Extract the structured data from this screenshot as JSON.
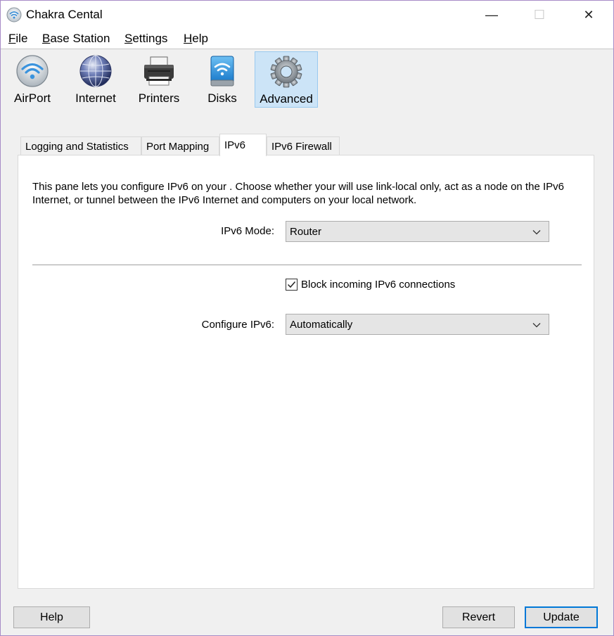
{
  "window": {
    "title": "Chakra Cental",
    "minimize_glyph": "—",
    "maximize_glyph": "☐",
    "close_glyph": "✕"
  },
  "menu": [
    {
      "label_u": "F",
      "label_rest": "ile"
    },
    {
      "label_u": "B",
      "label_rest": "ase Station"
    },
    {
      "label_u": "S",
      "label_rest": "ettings"
    },
    {
      "label_u": "H",
      "label_rest": "elp"
    }
  ],
  "toolbar": [
    {
      "label": "AirPort",
      "icon": "airport-wifi-icon"
    },
    {
      "label": "Internet",
      "icon": "globe-icon"
    },
    {
      "label": "Printers",
      "icon": "printer-icon"
    },
    {
      "label": "Disks",
      "icon": "disk-icon"
    },
    {
      "label": "Advanced",
      "icon": "gear-icon",
      "active": true
    }
  ],
  "tabs": [
    {
      "label": "Logging and Statistics"
    },
    {
      "label": "Port Mapping"
    },
    {
      "label": "IPv6",
      "selected": true
    },
    {
      "label": "IPv6 Firewall"
    }
  ],
  "pane": {
    "description": "This pane lets you configure IPv6 on your . Choose whether your  will use link-local only, act as a node on the IPv6 Internet, or tunnel between the IPv6 Internet and computers on your local network.",
    "ipv6_mode_label": "IPv6 Mode:",
    "ipv6_mode_value": "Router",
    "block_incoming_label": "Block incoming IPv6 connections",
    "block_incoming_checked": true,
    "configure_label": "Configure IPv6:",
    "configure_value": "Automatically"
  },
  "buttons": {
    "help": "Help",
    "revert": "Revert",
    "update": "Update"
  },
  "colors": {
    "active_tool_bg": "#cce4f7",
    "default_button_border": "#0078d7",
    "window_border": "#a78bc7"
  }
}
